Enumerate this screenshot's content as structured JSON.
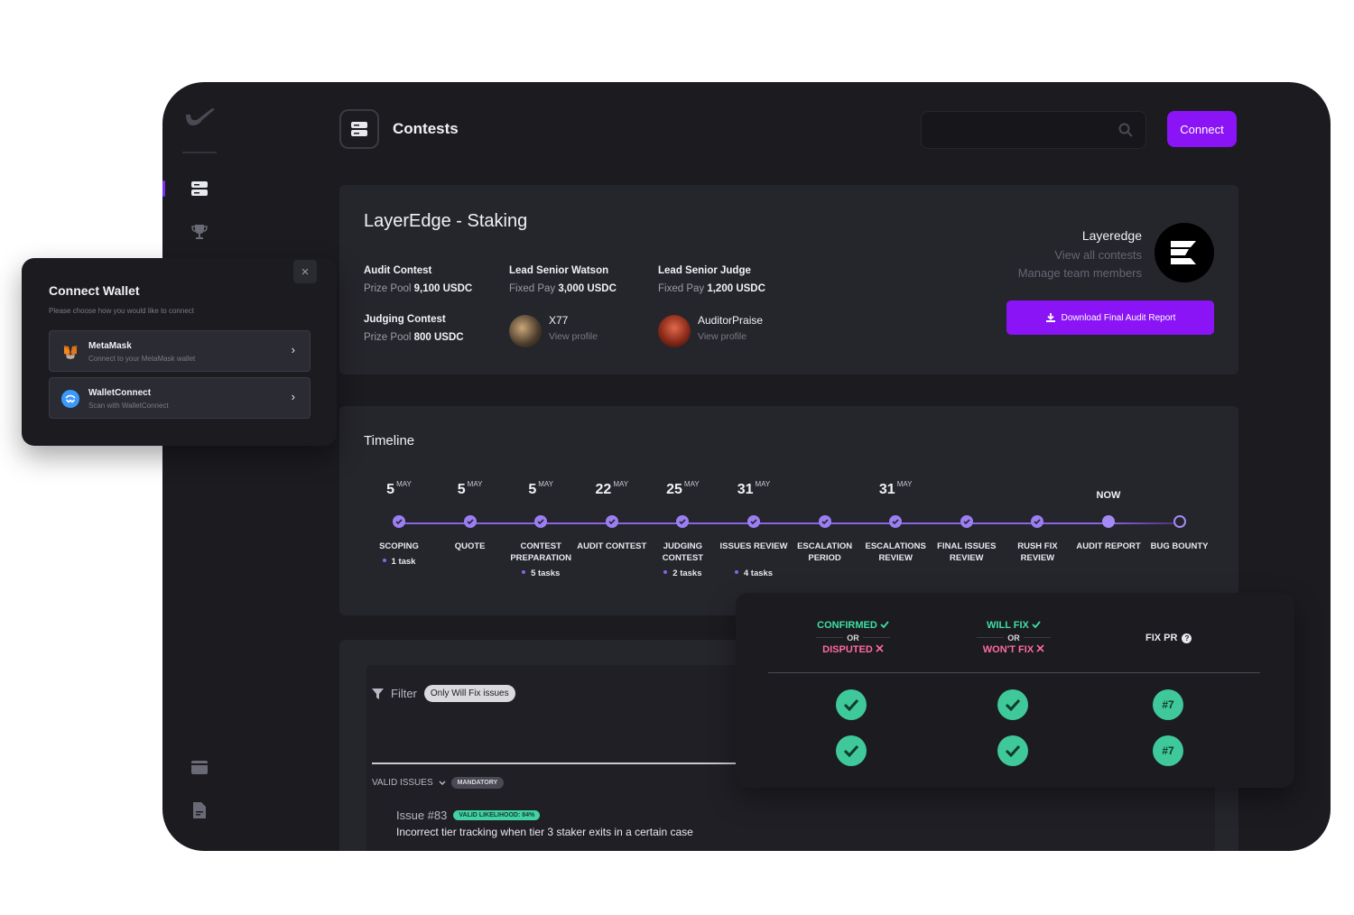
{
  "header": {
    "title": "Contests",
    "connect_label": "Connect"
  },
  "contest": {
    "title": "LayerEdge - Staking",
    "audit_contest_label": "Audit Contest",
    "audit_prize_label": "Prize Pool",
    "audit_prize_value": "9,100 USDC",
    "judging_contest_label": "Judging Contest",
    "judging_prize_label": "Prize Pool",
    "judging_prize_value": "800 USDC",
    "lead_watson_label": "Lead Senior Watson",
    "lead_watson_pay_label": "Fixed Pay",
    "lead_watson_pay_value": "3,000 USDC",
    "lead_judge_label": "Lead Senior Judge",
    "lead_judge_pay_label": "Fixed Pay",
    "lead_judge_pay_value": "1,200 USDC",
    "watson_name": "X77",
    "watson_link": "View profile",
    "judge_name": "AuditorPraise",
    "judge_link": "View profile",
    "org_name": "Layeredge",
    "org_link_contests": "View all contests",
    "org_link_team": "Manage team members",
    "download_label": "Download Final Audit Report"
  },
  "timeline": {
    "title": "Timeline",
    "now_label": "NOW",
    "steps": [
      {
        "day": "5",
        "month": "MAY",
        "label": "SCOPING",
        "tasks": "1 task"
      },
      {
        "day": "5",
        "month": "MAY",
        "label": "QUOTE",
        "tasks": ""
      },
      {
        "day": "5",
        "month": "MAY",
        "label": "CONTEST PREPARATION",
        "tasks": "5 tasks"
      },
      {
        "day": "22",
        "month": "MAY",
        "label": "AUDIT CONTEST",
        "tasks": ""
      },
      {
        "day": "25",
        "month": "MAY",
        "label": "JUDGING CONTEST",
        "tasks": "2 tasks"
      },
      {
        "day": "31",
        "month": "MAY",
        "label": "ISSUES REVIEW",
        "tasks": "4 tasks"
      },
      {
        "day": "",
        "month": "",
        "label": "ESCALATION PERIOD",
        "tasks": ""
      },
      {
        "day": "31",
        "month": "MAY",
        "label": "ESCALATIONS REVIEW",
        "tasks": ""
      },
      {
        "day": "",
        "month": "",
        "label": "FINAL ISSUES REVIEW",
        "tasks": ""
      },
      {
        "day": "",
        "month": "",
        "label": "RUSH FIX REVIEW",
        "tasks": ""
      },
      {
        "day": "",
        "month": "",
        "label": "AUDIT REPORT",
        "tasks": ""
      },
      {
        "day": "",
        "month": "",
        "label": "BUG BOUNTY",
        "tasks": ""
      }
    ]
  },
  "issues": {
    "filter_label": "Filter",
    "filter_chip": "Only Will Fix issues",
    "valid_issues_label": "VALID ISSUES",
    "mandatory_badge": "MANDATORY",
    "issue_id": "Issue #83",
    "likelihood_badge": "VALID LIKELIHOOD: 84%",
    "issue_title": "Incorrect tier tracking when tier 3 staker exits in a certain case"
  },
  "wallet_modal": {
    "title": "Connect Wallet",
    "subtitle": "Please choose how you would like to connect",
    "options": [
      {
        "name": "MetaMask",
        "desc": "Connect to your MetaMask wallet"
      },
      {
        "name": "WalletConnect",
        "desc": "Scan with WalletConnect"
      }
    ],
    "close_glyph": "×"
  },
  "fix_panel": {
    "col1_good": "CONFIRMED",
    "col1_or": "OR",
    "col1_bad": "DISPUTED",
    "col2_good": "WILL FIX",
    "col2_or": "OR",
    "col2_bad": "WON'T FIX",
    "col3_label": "FIX PR",
    "pr_value": "#7"
  },
  "colors": {
    "accent": "#8a14f5",
    "timeline": "#9b7ff2",
    "success": "#3fc89a",
    "danger": "#ff6b9d",
    "background": "#1b1b20",
    "card": "#25252c"
  },
  "icons": [
    "logo-icon",
    "server-icon",
    "trophy-icon",
    "wallet-icon",
    "document-icon",
    "search-icon",
    "download-icon",
    "metamask-icon",
    "walletconnect-icon",
    "chevron-right-icon",
    "close-icon",
    "filter-icon",
    "chevron-down-icon",
    "check-icon",
    "help-icon"
  ]
}
